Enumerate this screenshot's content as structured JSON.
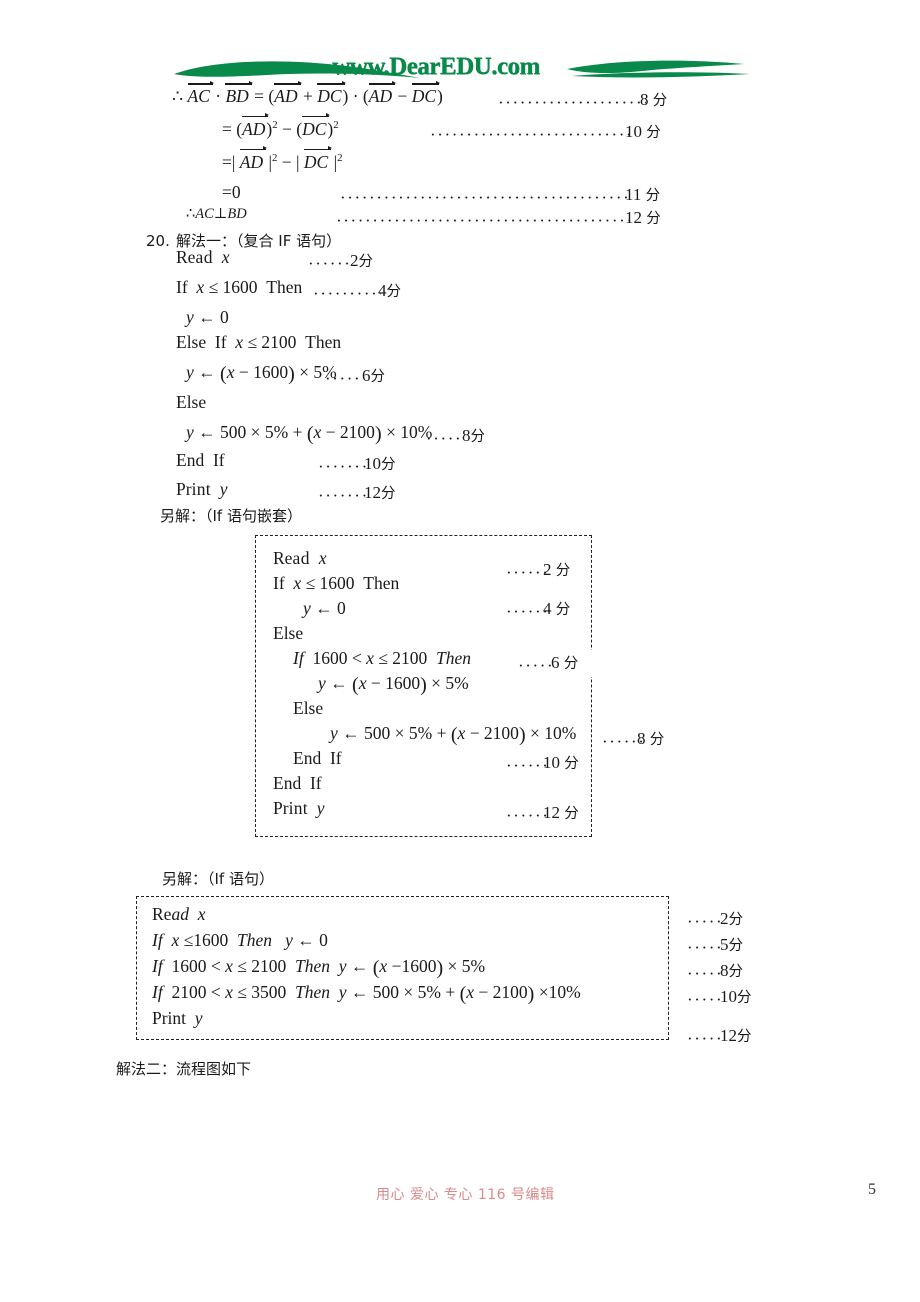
{
  "logo": {
    "text": "www.DearEDU.com",
    "color": "#0a8a4a"
  },
  "proof": {
    "lines": [
      {
        "id": "l1",
        "expr": "∴ AC·BD = (AD + DC)·(AD − DC)",
        "score": "8 分"
      },
      {
        "id": "l2",
        "expr": "= (AD)² − (DC)²",
        "score": "10 分"
      },
      {
        "id": "l3",
        "expr": "=| AD |² − | DC |²",
        "score": ""
      },
      {
        "id": "l4",
        "expr": "=0",
        "score": "11 分"
      },
      {
        "id": "l5",
        "expr": "∴ AC⊥BD",
        "score": "12 分"
      }
    ],
    "eq0": "=0",
    "conclusion": "AC⊥BD"
  },
  "problem20": {
    "number": "20.",
    "method1_label": "解法一：（复合 IF 语句）",
    "code1": [
      {
        "code": "Read  x",
        "score": "2分"
      },
      {
        "code": "If  x ≤ 1600  Then",
        "score": "4分"
      },
      {
        "code": "y ← 0",
        "score": ""
      },
      {
        "code": "Else  If  x ≤ 2100  Then",
        "score": ""
      },
      {
        "code": "y ← (x − 1600) × 5%",
        "score": "6分"
      },
      {
        "code": "Else",
        "score": ""
      },
      {
        "code": "y ← 500 × 5% + (x − 2100) × 10%",
        "score": "8分"
      },
      {
        "code": "End  If",
        "score": "10分"
      },
      {
        "code": "Print  y",
        "score": "12分"
      }
    ],
    "alt1_label": "另解：（If 语句嵌套）",
    "code2": [
      {
        "code": "Read  x",
        "score": "2 分"
      },
      {
        "code": "If  x ≤ 1600  Then",
        "score": ""
      },
      {
        "code": "y ← 0",
        "score": "4 分"
      },
      {
        "code": "Else",
        "score": ""
      },
      {
        "code": "If  1600 < x ≤ 2100  Then",
        "score": "6 分"
      },
      {
        "code": "y ← (x − 1600) × 5%",
        "score": ""
      },
      {
        "code": "Else",
        "score": ""
      },
      {
        "code": "y ← 500 × 5% + (x − 2100) × 10%",
        "score": "8 分"
      },
      {
        "code": "End  If",
        "score": "10 分"
      },
      {
        "code": "End  If",
        "score": ""
      },
      {
        "code": "Print  y",
        "score": "12 分"
      }
    ],
    "alt2_label": "另解：（If 语句）",
    "code3": [
      {
        "code": "Read  x",
        "score": "2 分"
      },
      {
        "code": "If  x ≤ 1600  Then    y ← 0",
        "score": "5 分"
      },
      {
        "code": "If  1600 < x ≤ 2100  Then   y ← (x − 1600) × 5%",
        "score": "8 分"
      },
      {
        "code": "If  2100 < x ≤ 3500  Then   y ← 500 × 5% + (x − 2100) × 10%",
        "score": "10 分"
      },
      {
        "code": "Print  y",
        "score": "12 分"
      }
    ],
    "method2_label": "解法二：流程图如下"
  },
  "footer": {
    "note": "用心  爱心  专心    116 号编辑",
    "page_number": "5",
    "note_color": "#d98a8a"
  }
}
